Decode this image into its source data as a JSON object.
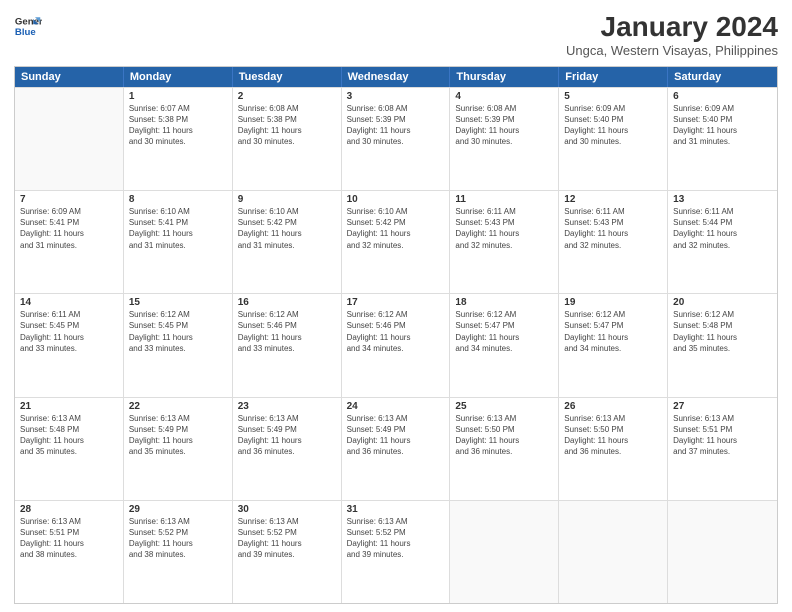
{
  "logo": {
    "line1": "General",
    "line2": "Blue"
  },
  "title": "January 2024",
  "subtitle": "Ungca, Western Visayas, Philippines",
  "header_days": [
    "Sunday",
    "Monday",
    "Tuesday",
    "Wednesday",
    "Thursday",
    "Friday",
    "Saturday"
  ],
  "weeks": [
    [
      {
        "day": "",
        "info": ""
      },
      {
        "day": "1",
        "info": "Sunrise: 6:07 AM\nSunset: 5:38 PM\nDaylight: 11 hours\nand 30 minutes."
      },
      {
        "day": "2",
        "info": "Sunrise: 6:08 AM\nSunset: 5:38 PM\nDaylight: 11 hours\nand 30 minutes."
      },
      {
        "day": "3",
        "info": "Sunrise: 6:08 AM\nSunset: 5:39 PM\nDaylight: 11 hours\nand 30 minutes."
      },
      {
        "day": "4",
        "info": "Sunrise: 6:08 AM\nSunset: 5:39 PM\nDaylight: 11 hours\nand 30 minutes."
      },
      {
        "day": "5",
        "info": "Sunrise: 6:09 AM\nSunset: 5:40 PM\nDaylight: 11 hours\nand 30 minutes."
      },
      {
        "day": "6",
        "info": "Sunrise: 6:09 AM\nSunset: 5:40 PM\nDaylight: 11 hours\nand 31 minutes."
      }
    ],
    [
      {
        "day": "7",
        "info": "Sunrise: 6:09 AM\nSunset: 5:41 PM\nDaylight: 11 hours\nand 31 minutes."
      },
      {
        "day": "8",
        "info": "Sunrise: 6:10 AM\nSunset: 5:41 PM\nDaylight: 11 hours\nand 31 minutes."
      },
      {
        "day": "9",
        "info": "Sunrise: 6:10 AM\nSunset: 5:42 PM\nDaylight: 11 hours\nand 31 minutes."
      },
      {
        "day": "10",
        "info": "Sunrise: 6:10 AM\nSunset: 5:42 PM\nDaylight: 11 hours\nand 32 minutes."
      },
      {
        "day": "11",
        "info": "Sunrise: 6:11 AM\nSunset: 5:43 PM\nDaylight: 11 hours\nand 32 minutes."
      },
      {
        "day": "12",
        "info": "Sunrise: 6:11 AM\nSunset: 5:43 PM\nDaylight: 11 hours\nand 32 minutes."
      },
      {
        "day": "13",
        "info": "Sunrise: 6:11 AM\nSunset: 5:44 PM\nDaylight: 11 hours\nand 32 minutes."
      }
    ],
    [
      {
        "day": "14",
        "info": "Sunrise: 6:11 AM\nSunset: 5:45 PM\nDaylight: 11 hours\nand 33 minutes."
      },
      {
        "day": "15",
        "info": "Sunrise: 6:12 AM\nSunset: 5:45 PM\nDaylight: 11 hours\nand 33 minutes."
      },
      {
        "day": "16",
        "info": "Sunrise: 6:12 AM\nSunset: 5:46 PM\nDaylight: 11 hours\nand 33 minutes."
      },
      {
        "day": "17",
        "info": "Sunrise: 6:12 AM\nSunset: 5:46 PM\nDaylight: 11 hours\nand 34 minutes."
      },
      {
        "day": "18",
        "info": "Sunrise: 6:12 AM\nSunset: 5:47 PM\nDaylight: 11 hours\nand 34 minutes."
      },
      {
        "day": "19",
        "info": "Sunrise: 6:12 AM\nSunset: 5:47 PM\nDaylight: 11 hours\nand 34 minutes."
      },
      {
        "day": "20",
        "info": "Sunrise: 6:12 AM\nSunset: 5:48 PM\nDaylight: 11 hours\nand 35 minutes."
      }
    ],
    [
      {
        "day": "21",
        "info": "Sunrise: 6:13 AM\nSunset: 5:48 PM\nDaylight: 11 hours\nand 35 minutes."
      },
      {
        "day": "22",
        "info": "Sunrise: 6:13 AM\nSunset: 5:49 PM\nDaylight: 11 hours\nand 35 minutes."
      },
      {
        "day": "23",
        "info": "Sunrise: 6:13 AM\nSunset: 5:49 PM\nDaylight: 11 hours\nand 36 minutes."
      },
      {
        "day": "24",
        "info": "Sunrise: 6:13 AM\nSunset: 5:49 PM\nDaylight: 11 hours\nand 36 minutes."
      },
      {
        "day": "25",
        "info": "Sunrise: 6:13 AM\nSunset: 5:50 PM\nDaylight: 11 hours\nand 36 minutes."
      },
      {
        "day": "26",
        "info": "Sunrise: 6:13 AM\nSunset: 5:50 PM\nDaylight: 11 hours\nand 36 minutes."
      },
      {
        "day": "27",
        "info": "Sunrise: 6:13 AM\nSunset: 5:51 PM\nDaylight: 11 hours\nand 37 minutes."
      }
    ],
    [
      {
        "day": "28",
        "info": "Sunrise: 6:13 AM\nSunset: 5:51 PM\nDaylight: 11 hours\nand 38 minutes."
      },
      {
        "day": "29",
        "info": "Sunrise: 6:13 AM\nSunset: 5:52 PM\nDaylight: 11 hours\nand 38 minutes."
      },
      {
        "day": "30",
        "info": "Sunrise: 6:13 AM\nSunset: 5:52 PM\nDaylight: 11 hours\nand 39 minutes."
      },
      {
        "day": "31",
        "info": "Sunrise: 6:13 AM\nSunset: 5:52 PM\nDaylight: 11 hours\nand 39 minutes."
      },
      {
        "day": "",
        "info": ""
      },
      {
        "day": "",
        "info": ""
      },
      {
        "day": "",
        "info": ""
      }
    ]
  ]
}
